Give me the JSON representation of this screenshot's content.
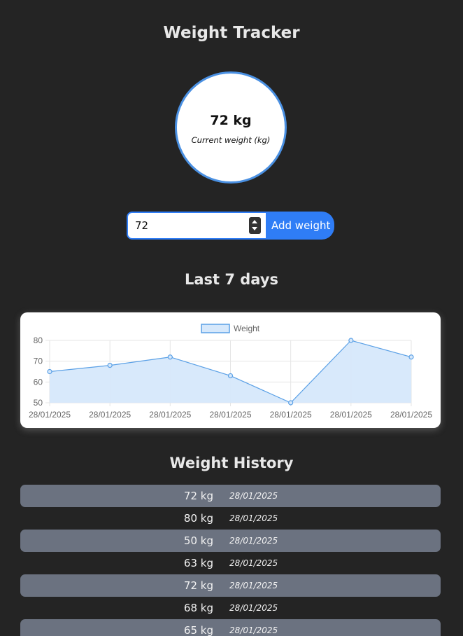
{
  "app": {
    "title": "Weight Tracker"
  },
  "current": {
    "value": "72 kg",
    "label": "Current weight (kg)"
  },
  "form": {
    "input_value": "72",
    "add_label": "Add weight"
  },
  "sections": {
    "chart_title": "Last 7 days",
    "history_title": "Weight History"
  },
  "colors": {
    "accent": "#2f7df6",
    "line": "#5aa0e6",
    "fill": "#d6e8fb",
    "row_alt": "#6b7280",
    "background": "#242424"
  },
  "chart_data": {
    "type": "line",
    "legend": [
      "Weight"
    ],
    "legend_position": "top",
    "categories": [
      "28/01/2025",
      "28/01/2025",
      "28/01/2025",
      "28/01/2025",
      "28/01/2025",
      "28/01/2025",
      "28/01/2025"
    ],
    "series": [
      {
        "name": "Weight",
        "values": [
          65,
          68,
          72,
          63,
          50,
          80,
          72
        ]
      }
    ],
    "yticks": [
      "80",
      "70",
      "60",
      "50"
    ],
    "ylim": [
      50,
      80
    ],
    "fill": true,
    "grid": true
  },
  "history": [
    {
      "weight": "72 kg",
      "date": "28/01/2025"
    },
    {
      "weight": "80 kg",
      "date": "28/01/2025"
    },
    {
      "weight": "50 kg",
      "date": "28/01/2025"
    },
    {
      "weight": "63 kg",
      "date": "28/01/2025"
    },
    {
      "weight": "72 kg",
      "date": "28/01/2025"
    },
    {
      "weight": "68 kg",
      "date": "28/01/2025"
    },
    {
      "weight": "65 kg",
      "date": "28/01/2025"
    }
  ]
}
